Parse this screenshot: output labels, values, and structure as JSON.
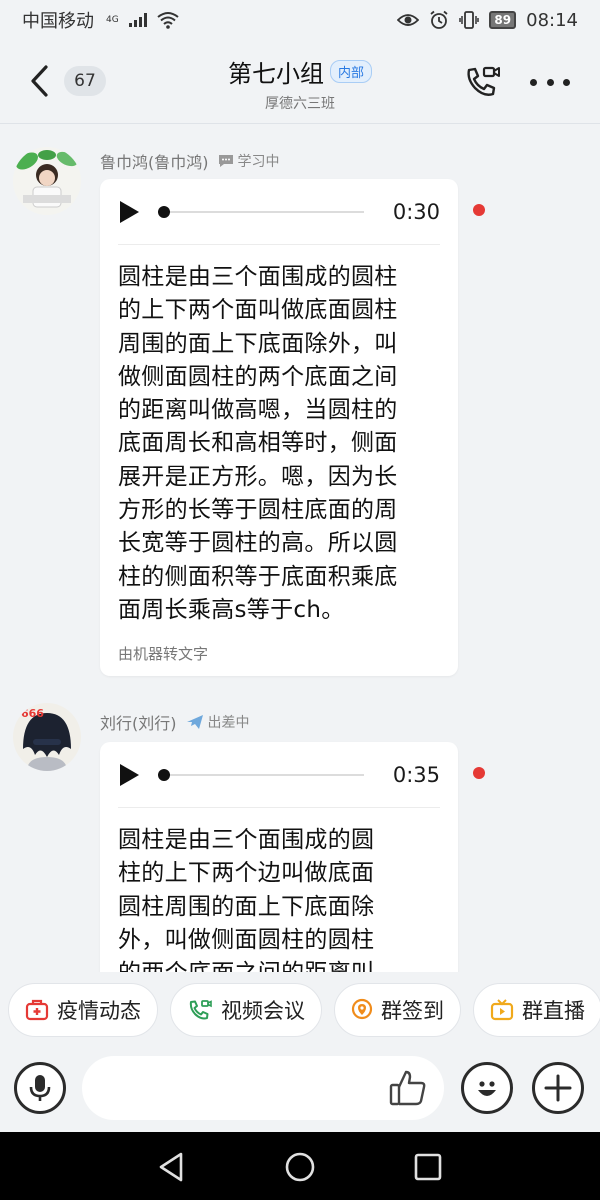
{
  "status_bar": {
    "carrier": "中国移动",
    "network": "4G",
    "battery": "89",
    "time": "08:14"
  },
  "header": {
    "unread_count": "67",
    "title": "第七小组",
    "badge": "内部",
    "subtitle": "厚德六三班"
  },
  "messages": [
    {
      "sender": "鲁巾鸿(鲁巾鸿)",
      "status": "学习中",
      "status_icon": "chat-bubble-icon",
      "duration": "0:30",
      "unread": true,
      "lines": [
        "圆柱是由三个面围成的圆柱",
        "的上下两个面叫做底面圆柱",
        "周围的面上下底面除外，叫",
        "做侧面圆柱的两个底面之间",
        "的距离叫做高嗯，当圆柱的",
        "底面周长和高相等时，侧面",
        "展开是正方形。嗯，因为长",
        "方形的长等于圆柱底面的周",
        "长宽等于圆柱的高。所以圆",
        "柱的侧面积等于底面积乘底",
        "面周长乘高s等于ch。"
      ],
      "source_note": "由机器转文字"
    },
    {
      "sender": "刘行(刘行)",
      "status": "出差中",
      "status_icon": "airplane-icon",
      "duration": "0:35",
      "unread": true,
      "lines": [
        "圆柱是由三个面围成的圆",
        "柱的上下两个边叫做底面",
        "圆柱周围的面上下底面除",
        "外，叫做侧面圆柱的圆柱",
        "的两个底面之间的距离叫"
      ]
    }
  ],
  "quick_actions": [
    {
      "label": "疫情动态",
      "icon": "medical-kit-icon",
      "color": "#e53935"
    },
    {
      "label": "视频会议",
      "icon": "video-call-icon",
      "color": "#2e9e57"
    },
    {
      "label": "群签到",
      "icon": "location-pin-icon",
      "color": "#f08c1b"
    },
    {
      "label": "群直播",
      "icon": "live-tv-icon",
      "color": "#f0a91b"
    }
  ],
  "colors": {
    "accent_blue": "#2a7ae2",
    "unread_red": "#e53935",
    "background": "#f1f3f5"
  }
}
